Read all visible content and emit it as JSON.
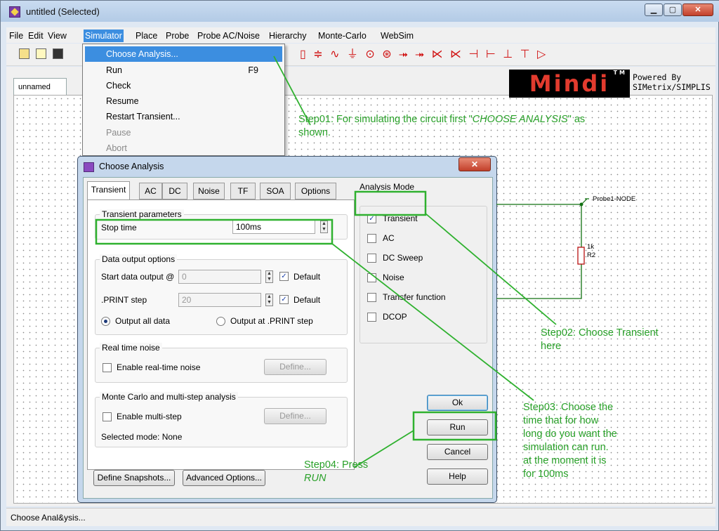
{
  "window": {
    "title": "untitled (Selected)",
    "controls": {
      "minimize": "▁",
      "maximize": "▢",
      "close": "✕"
    }
  },
  "menubar": [
    "File",
    "Edit",
    "View",
    "Simulator",
    "Place",
    "Probe",
    "Probe AC/Noise",
    "Hierarchy",
    "Monte-Carlo",
    "WebSim"
  ],
  "simulator_menu": [
    {
      "label": "Choose Analysis...",
      "shortcut": "",
      "state": "highlighted"
    },
    {
      "label": "Run",
      "shortcut": "F9",
      "state": "enabled"
    },
    {
      "label": "Check",
      "shortcut": "",
      "state": "enabled"
    },
    {
      "label": "Resume",
      "shortcut": "",
      "state": "enabled"
    },
    {
      "label": "Restart Transient...",
      "shortcut": "",
      "state": "enabled"
    },
    {
      "label": "Pause",
      "shortcut": "",
      "state": "disabled"
    },
    {
      "label": "Abort",
      "shortcut": "",
      "state": "disabled"
    }
  ],
  "toolbar": {
    "component_icons": "▯ ≑ ∿ ⏚ ⊙ ⊛ ⯮ ⯮ ⋉ ⋉ ⊣ ⊢ ⊥ ⊤ ▷",
    "icon_names": [
      "open-folder-icon",
      "new-file-icon",
      "save-icon"
    ]
  },
  "schematic_tab": "unnamed",
  "branding": {
    "logo_text": "Mindi",
    "logo_tm": "TM",
    "powered_by": "Powered By SIMetrix/SIMPLIS"
  },
  "schematic": {
    "probe_label": "Probe1-NODE",
    "resistor_value": "1k",
    "resistor_name": "R2"
  },
  "dialog": {
    "title": "Choose Analysis",
    "close": "✕",
    "tabs": [
      "Transient",
      "AC",
      "DC",
      "Noise",
      "TF",
      "SOA",
      "Options"
    ],
    "selected_tab": "Transient",
    "transient_parameters": {
      "group_title": "Transient parameters",
      "stop_time_label": "Stop time",
      "stop_time_value": "100ms"
    },
    "data_output": {
      "group_title": "Data output options",
      "start_label": "Start data output @",
      "start_value": "0",
      "start_default_label": "Default",
      "print_step_label": ".PRINT step",
      "print_step_value": "20",
      "print_default_label": "Default",
      "radio_all": "Output all data",
      "radio_print": "Output at .PRINT step"
    },
    "real_time_noise": {
      "group_title": "Real time noise",
      "checkbox": "Enable real-time noise",
      "define": "Define..."
    },
    "monte_carlo": {
      "group_title": "Monte Carlo and multi-step analysis",
      "checkbox": "Enable multi-step",
      "define": "Define...",
      "selected_mode": "Selected mode: None"
    },
    "analysis_mode": {
      "title": "Analysis Mode",
      "options": [
        {
          "label": "Transient",
          "checked": true
        },
        {
          "label": "AC",
          "checked": false
        },
        {
          "label": "DC Sweep",
          "checked": false
        },
        {
          "label": "Noise",
          "checked": false
        },
        {
          "label": "Transfer function",
          "checked": false
        },
        {
          "label": "DCOP",
          "checked": false
        }
      ]
    },
    "buttons": {
      "define_snapshots": "Define Snapshots...",
      "advanced_options": "Advanced Options...",
      "ok": "Ok",
      "run": "Run",
      "cancel": "Cancel",
      "help": "Help"
    }
  },
  "annotations": {
    "step01_a": "Step01: For simulating the circuit first \"",
    "step01_b": "CHOOSE ANALYSIS",
    "step01_c": "\" as",
    "step01_d": "shown.",
    "step02_a": "Step02: Choose Transient",
    "step02_b": "here",
    "step03": [
      "Step03: Choose the",
      "time that for how",
      "long do you want the",
      "simulation can run.",
      "at the moment it is",
      "for 100ms"
    ],
    "step04_a": "Step04: Press",
    "step04_b": "RUN",
    "color": "#28a028"
  },
  "statusbar": "Choose Anal&ysis..."
}
